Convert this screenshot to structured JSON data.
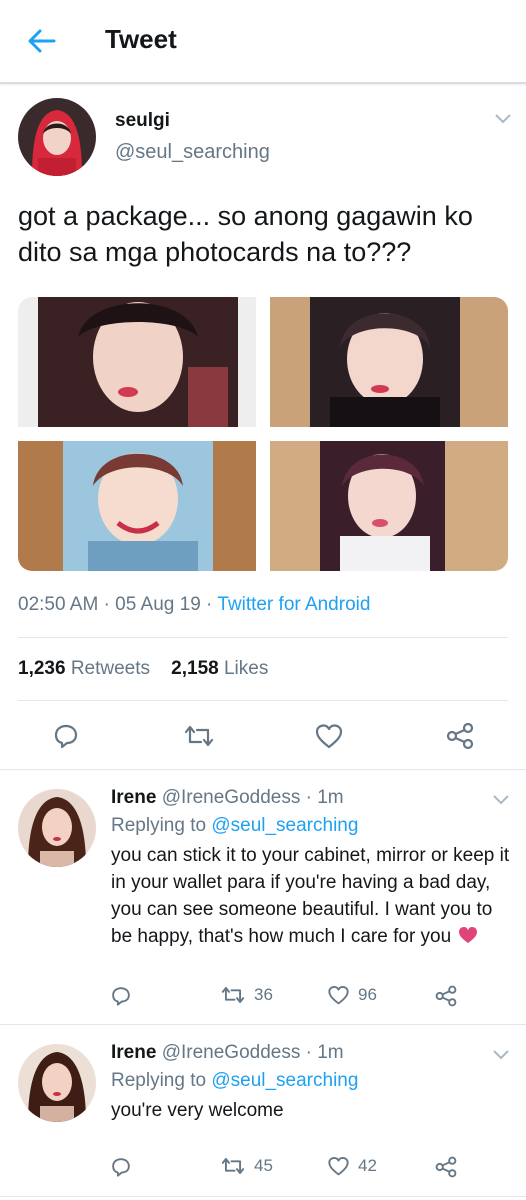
{
  "header": {
    "title": "Tweet"
  },
  "tweet": {
    "author_name": "seulgi",
    "author_handle": "@seul_searching",
    "text": "got a package... so anong gagawin ko dito sa mga photocards na to???",
    "time": "02:50 AM",
    "date": "05 Aug 19",
    "sep": "·",
    "source": "Twitter for Android",
    "retweets_count": "1,236",
    "retweets_label": "Retweets",
    "likes_count": "2,158",
    "likes_label": "Likes"
  },
  "replies": [
    {
      "name": "Irene",
      "handle": "@IreneGoddess",
      "time": "1m",
      "replying_label": "Replying to",
      "replying_to": "@seul_searching",
      "text": "you can stick it to your cabinet, mirror or keep it in your wallet para if you're having a bad day, you can see someone beautiful. I want you to be happy, that's how much I care for you",
      "retweets": "36",
      "likes": "96"
    },
    {
      "name": "Irene",
      "handle": "@IreneGoddess",
      "time": "1m",
      "replying_label": "Replying to",
      "replying_to": "@seul_searching",
      "text": "you're very welcome",
      "retweets": "45",
      "likes": "42"
    }
  ],
  "colors": {
    "accent": "#1da1f2",
    "secondary_text": "#657786",
    "heart": "#e0245e"
  }
}
